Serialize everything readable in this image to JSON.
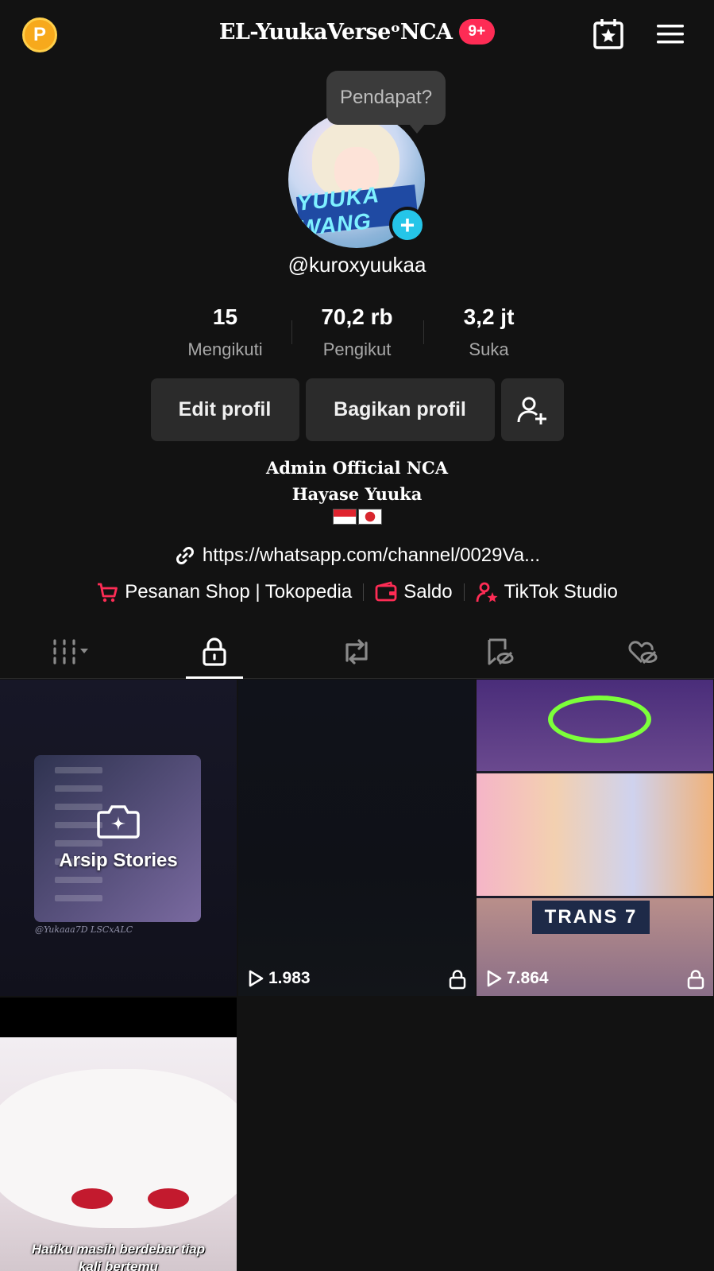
{
  "header": {
    "coin_symbol": "P",
    "title": "EL-YuukaVerseᵒNCA",
    "notification_badge": "9+"
  },
  "tooltip": {
    "text": "Pendapat?"
  },
  "avatar": {
    "banner_text": "YUUKA WANG"
  },
  "profile": {
    "username": "@kuroxyuukaa",
    "stats": [
      {
        "value": "15",
        "label": "Mengikuti"
      },
      {
        "value": "70,2 rb",
        "label": "Pengikut"
      },
      {
        "value": "3,2 jt",
        "label": "Suka"
      }
    ],
    "buttons": {
      "edit": "Edit profil",
      "share": "Bagikan profil"
    },
    "bio_line1": "Admin Official NCA",
    "bio_line2": "Hayase Yuuka",
    "link": "https://whatsapp.com/channel/0029Va..."
  },
  "shortcuts": [
    {
      "label": "Pesanan Shop | Tokopedia",
      "icon": "cart-icon"
    },
    {
      "label": "Saldo",
      "icon": "wallet-icon"
    },
    {
      "label": "TikTok Studio",
      "icon": "studio-icon"
    }
  ],
  "tabs": [
    {
      "name": "videos-grid",
      "icon": "grid-icon",
      "active": false
    },
    {
      "name": "private",
      "icon": "lock-icon",
      "active": true
    },
    {
      "name": "reposts",
      "icon": "repost-icon",
      "active": false
    },
    {
      "name": "favorites",
      "icon": "bookmark-hidden-icon",
      "active": false
    },
    {
      "name": "liked",
      "icon": "heart-hidden-icon",
      "active": false
    }
  ],
  "grid": {
    "story_archive_label": "Arsip Stories",
    "story_credit": "@Yukaaa7D LSCxALC",
    "video2_views": "1.983",
    "video3_views": "7.864",
    "video3_logo": "TRANS 7",
    "video4_caption_line1": "Hatiku masih berdebar tiap",
    "video4_caption_line2": "kali bertemu"
  },
  "colors": {
    "accent": "#fe2c55",
    "add_button": "#25c5e8",
    "coin": "#f7a91c",
    "background": "#121212"
  }
}
